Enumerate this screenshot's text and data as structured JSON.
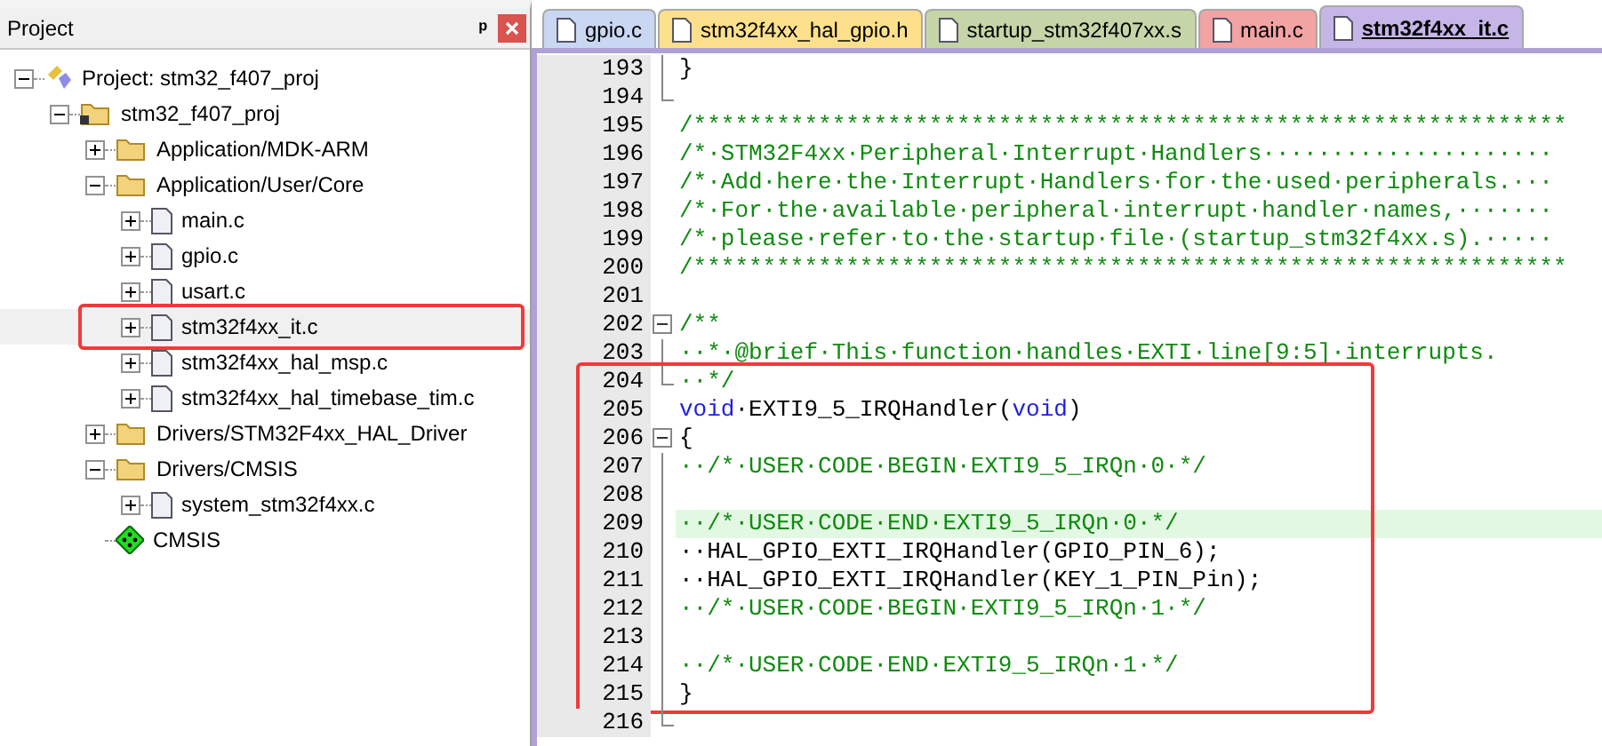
{
  "project_panel": {
    "title": "Project",
    "pin": "ᵖ",
    "tree": [
      {
        "label": "Project: stm32_f407_proj",
        "kind": "project",
        "expanded": true,
        "boxed": false,
        "children": [
          {
            "label": "stm32_f407_proj",
            "kind": "target",
            "expanded": true,
            "boxed": false,
            "children": [
              {
                "label": "Application/MDK-ARM",
                "kind": "folder",
                "expanded": false,
                "boxed": false
              },
              {
                "label": "Application/User/Core",
                "kind": "folder",
                "expanded": true,
                "boxed": false,
                "children": [
                  {
                    "label": "main.c",
                    "kind": "file",
                    "expanded": false,
                    "boxed": false
                  },
                  {
                    "label": "gpio.c",
                    "kind": "file",
                    "expanded": false,
                    "boxed": false
                  },
                  {
                    "label": "usart.c",
                    "kind": "file",
                    "expanded": false,
                    "boxed": false
                  },
                  {
                    "label": "stm32f4xx_it.c",
                    "kind": "file",
                    "expanded": false,
                    "boxed": true
                  },
                  {
                    "label": "stm32f4xx_hal_msp.c",
                    "kind": "file",
                    "expanded": false,
                    "boxed": false
                  },
                  {
                    "label": "stm32f4xx_hal_timebase_tim.c",
                    "kind": "file",
                    "expanded": false,
                    "boxed": false
                  }
                ]
              },
              {
                "label": "Drivers/STM32F4xx_HAL_Driver",
                "kind": "folder",
                "expanded": false,
                "boxed": false
              },
              {
                "label": "Drivers/CMSIS",
                "kind": "folder",
                "expanded": true,
                "boxed": false,
                "children": [
                  {
                    "label": "system_stm32f4xx.c",
                    "kind": "file",
                    "expanded": false,
                    "boxed": false
                  }
                ]
              },
              {
                "label": "CMSIS",
                "kind": "component",
                "boxed": false
              }
            ]
          }
        ]
      }
    ]
  },
  "tabs": [
    {
      "label": "gpio.c",
      "color": "#c9d7f3",
      "selected": false
    },
    {
      "label": "stm32f4xx_hal_gpio.h",
      "color": "#fde08c",
      "selected": false
    },
    {
      "label": "startup_stm32f407xx.s",
      "color": "#c5d5a8",
      "selected": false
    },
    {
      "label": "main.c",
      "color": "#f2a3a3",
      "selected": false
    },
    {
      "label": "stm32f4xx_it.c",
      "color": "#c6b6e8",
      "selected": true
    }
  ],
  "editor": {
    "blocks": [
      {
        "boxed": false,
        "lines": [
          {
            "number": "193",
            "fold": {
              "kind": "line"
            },
            "current": false,
            "parts": [
              {
                "kind": "plain",
                "text": "}"
              }
            ]
          },
          {
            "number": "194",
            "fold": {
              "kind": "end"
            },
            "current": false
          },
          {
            "number": "195",
            "current": false,
            "parts": [
              {
                "kind": "comment",
                "text": "/***************************************************************"
              }
            ]
          },
          {
            "number": "196",
            "current": false,
            "parts": [
              {
                "kind": "comment",
                "text": "/*·STM32F4xx·Peripheral·Interrupt·Handlers·····················"
              }
            ]
          },
          {
            "number": "197",
            "current": false,
            "parts": [
              {
                "kind": "comment",
                "text": "/*·Add·here·the·Interrupt·Handlers·for·the·used·peripherals.···"
              }
            ]
          },
          {
            "number": "198",
            "current": false,
            "parts": [
              {
                "kind": "comment",
                "text": "/*·For·the·available·peripheral·interrupt·handler·names,·······"
              }
            ]
          },
          {
            "number": "199",
            "current": false,
            "parts": [
              {
                "kind": "comment",
                "text": "/*·please·refer·to·the·startup·file·(startup_stm32f4xx.s).·····"
              }
            ]
          },
          {
            "number": "200",
            "current": false,
            "parts": [
              {
                "kind": "comment",
                "text": "/***************************************************************"
              }
            ]
          },
          {
            "number": "201",
            "current": false
          },
          {
            "number": "202",
            "fold": {
              "kind": "start"
            },
            "current": false,
            "parts": [
              {
                "kind": "comment",
                "text": "/**"
              }
            ]
          },
          {
            "number": "203",
            "fold": {
              "kind": "line"
            },
            "current": false,
            "parts": [
              {
                "kind": "comment",
                "text": "··*·@brief·This·function·handles·EXTI·line[9:5]·interrupts."
              }
            ]
          }
        ]
      },
      {
        "boxed": true,
        "lines": [
          {
            "number": "204",
            "fold": {
              "kind": "end"
            },
            "current": false,
            "parts": [
              {
                "kind": "comment",
                "text": "··*/"
              }
            ]
          },
          {
            "number": "205",
            "current": false,
            "parts": [
              {
                "kind": "keyword",
                "text": "void"
              },
              {
                "kind": "plain",
                "text": "·EXTI9_5_IRQHandler("
              },
              {
                "kind": "keyword",
                "text": "void"
              },
              {
                "kind": "plain",
                "text": ")"
              }
            ]
          },
          {
            "number": "206",
            "fold": {
              "kind": "start"
            },
            "current": false,
            "parts": [
              {
                "kind": "plain",
                "text": "{"
              }
            ]
          },
          {
            "number": "207",
            "fold": {
              "kind": "line"
            },
            "current": false,
            "parts": [
              {
                "kind": "comment",
                "text": "··/*·USER·CODE·BEGIN·EXTI9_5_IRQn·0·*/"
              }
            ]
          },
          {
            "number": "208",
            "fold": {
              "kind": "line"
            },
            "current": false
          },
          {
            "number": "209",
            "fold": {
              "kind": "line"
            },
            "current": true,
            "parts": [
              {
                "kind": "comment",
                "text": "··/*·USER·CODE·END·EXTI9_5_IRQn·0·*/"
              }
            ]
          },
          {
            "number": "210",
            "fold": {
              "kind": "line"
            },
            "current": false,
            "parts": [
              {
                "kind": "plain",
                "text": "··HAL_GPIO_EXTI_IRQHandler(GPIO_PIN_6);"
              }
            ]
          },
          {
            "number": "211",
            "fold": {
              "kind": "line"
            },
            "current": false,
            "parts": [
              {
                "kind": "plain",
                "text": "··HAL_GPIO_EXTI_IRQHandler(KEY_1_PIN_Pin);"
              }
            ]
          },
          {
            "number": "212",
            "fold": {
              "kind": "line"
            },
            "current": false,
            "parts": [
              {
                "kind": "comment",
                "text": "··/*·USER·CODE·BEGIN·EXTI9_5_IRQn·1·*/"
              }
            ]
          },
          {
            "number": "213",
            "fold": {
              "kind": "line"
            },
            "current": false
          },
          {
            "number": "214",
            "fold": {
              "kind": "line"
            },
            "current": false,
            "parts": [
              {
                "kind": "comment",
                "text": "··/*·USER·CODE·END·EXTI9_5_IRQn·1·*/"
              }
            ]
          },
          {
            "number": "215",
            "fold": {
              "kind": "line"
            },
            "current": false,
            "parts": [
              {
                "kind": "plain",
                "text": "}"
              }
            ]
          }
        ]
      },
      {
        "boxed": false,
        "lines": [
          {
            "number": "216",
            "fold": {
              "kind": "end"
            },
            "current": false
          }
        ]
      }
    ]
  }
}
